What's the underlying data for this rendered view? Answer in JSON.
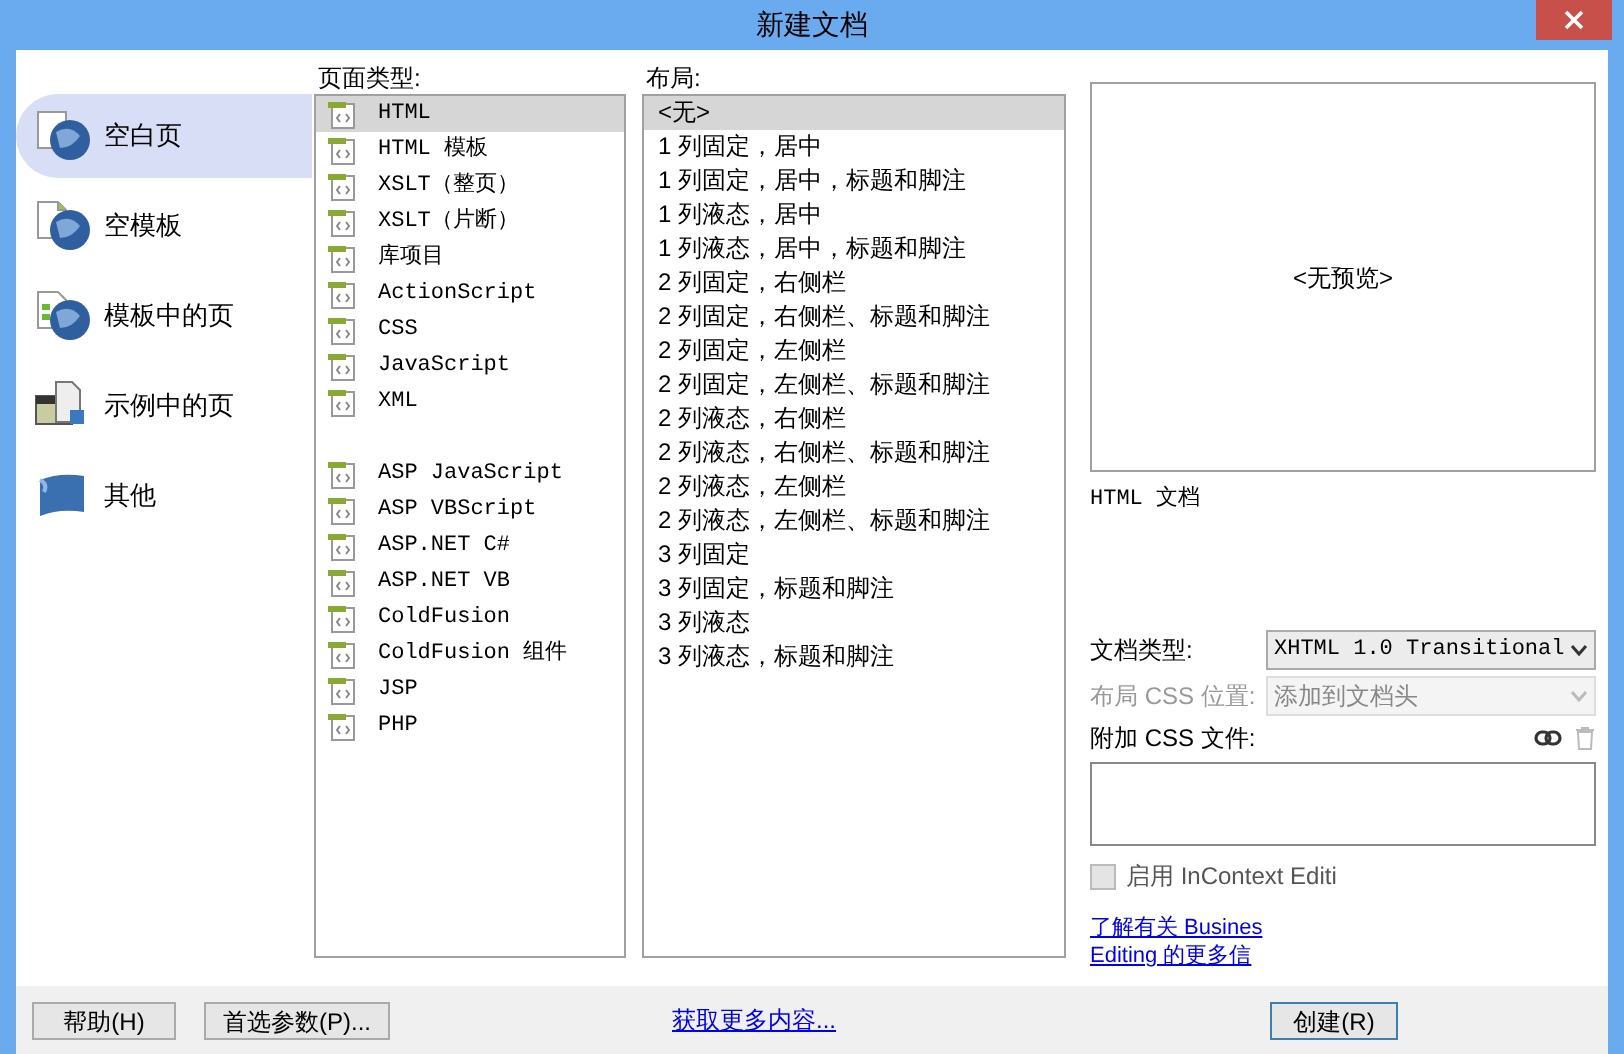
{
  "window": {
    "title": "新建文档"
  },
  "sidebar": {
    "items": [
      {
        "label": "空白页",
        "selected": true,
        "kind": "blank"
      },
      {
        "label": "空模板",
        "selected": false,
        "kind": "template"
      },
      {
        "label": "模板中的页",
        "selected": false,
        "kind": "template-page"
      },
      {
        "label": "示例中的页",
        "selected": false,
        "kind": "sample"
      },
      {
        "label": "其他",
        "selected": false,
        "kind": "other"
      }
    ]
  },
  "page_types": {
    "label": "页面类型:",
    "groups": [
      {
        "items": [
          {
            "label": "HTML",
            "selected": true
          },
          {
            "label": "HTML 模板",
            "selected": false
          },
          {
            "label": "XSLT（整页）",
            "selected": false
          },
          {
            "label": "XSLT（片断）",
            "selected": false
          },
          {
            "label": "库项目",
            "selected": false
          },
          {
            "label": "ActionScript",
            "selected": false
          },
          {
            "label": "CSS",
            "selected": false
          },
          {
            "label": "JavaScript",
            "selected": false
          },
          {
            "label": "XML",
            "selected": false
          }
        ]
      },
      {
        "items": [
          {
            "label": "ASP JavaScript",
            "selected": false
          },
          {
            "label": "ASP VBScript",
            "selected": false
          },
          {
            "label": "ASP.NET C#",
            "selected": false
          },
          {
            "label": "ASP.NET VB",
            "selected": false
          },
          {
            "label": "ColdFusion",
            "selected": false
          },
          {
            "label": "ColdFusion 组件",
            "selected": false
          },
          {
            "label": "JSP",
            "selected": false
          },
          {
            "label": "PHP",
            "selected": false
          }
        ]
      }
    ]
  },
  "layouts": {
    "label": "布局:",
    "items": [
      {
        "label": "<无>",
        "selected": true
      },
      {
        "label": "1 列固定，居中",
        "selected": false
      },
      {
        "label": "1 列固定，居中，标题和脚注",
        "selected": false
      },
      {
        "label": "1 列液态，居中",
        "selected": false
      },
      {
        "label": "1 列液态，居中，标题和脚注",
        "selected": false
      },
      {
        "label": "2 列固定，右侧栏",
        "selected": false
      },
      {
        "label": "2 列固定，右侧栏、标题和脚注",
        "selected": false
      },
      {
        "label": "2 列固定，左侧栏",
        "selected": false
      },
      {
        "label": "2 列固定，左侧栏、标题和脚注",
        "selected": false
      },
      {
        "label": "2 列液态，右侧栏",
        "selected": false
      },
      {
        "label": "2 列液态，右侧栏、标题和脚注",
        "selected": false
      },
      {
        "label": "2 列液态，左侧栏",
        "selected": false
      },
      {
        "label": "2 列液态，左侧栏、标题和脚注",
        "selected": false
      },
      {
        "label": "3 列固定",
        "selected": false
      },
      {
        "label": "3 列固定，标题和脚注",
        "selected": false
      },
      {
        "label": "3 列液态",
        "selected": false
      },
      {
        "label": "3 列液态，标题和脚注",
        "selected": false
      }
    ]
  },
  "preview": {
    "text": "<无预览>",
    "description": "HTML 文档"
  },
  "doc_type": {
    "label": "文档类型:",
    "value": "XHTML 1.0 Transitional",
    "disabled": false
  },
  "css_position": {
    "label": "布局 CSS 位置:",
    "value": "添加到文档头",
    "disabled": true
  },
  "attach_css": {
    "label": "附加 CSS 文件:"
  },
  "incontext": {
    "label": "启用 InContext Editi",
    "checked": false
  },
  "learn_more": [
    "了解有关 Busines",
    "Editing 的更多信"
  ],
  "footer": {
    "help": "帮助(H)",
    "prefs": "首选参数(P)...",
    "more": "获取更多内容...",
    "create": "创建(R)"
  }
}
